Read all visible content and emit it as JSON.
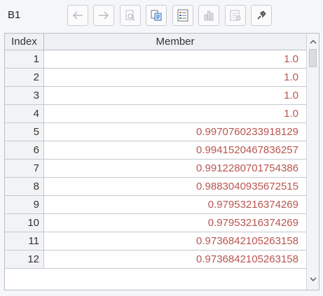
{
  "toolbar": {
    "cell_name": "B1",
    "buttons": [
      {
        "name": "back",
        "icon": "arrow-left-icon"
      },
      {
        "name": "forward",
        "icon": "arrow-right-icon"
      },
      {
        "name": "preview",
        "icon": "magnifier-page-icon"
      },
      {
        "name": "copy",
        "icon": "copy-icon"
      },
      {
        "name": "list",
        "icon": "list-form-icon"
      },
      {
        "name": "chart",
        "icon": "bar-chart-icon"
      },
      {
        "name": "settings",
        "icon": "table-settings-icon"
      },
      {
        "name": "pin",
        "icon": "pin-icon"
      }
    ]
  },
  "grid": {
    "headers": {
      "index": "Index",
      "member": "Member"
    },
    "rows": [
      {
        "index": "1",
        "member": "1.0"
      },
      {
        "index": "2",
        "member": "1.0"
      },
      {
        "index": "3",
        "member": "1.0"
      },
      {
        "index": "4",
        "member": "1.0"
      },
      {
        "index": "5",
        "member": "0.9970760233918129"
      },
      {
        "index": "6",
        "member": "0.9941520467836257"
      },
      {
        "index": "7",
        "member": "0.9912280701754386"
      },
      {
        "index": "8",
        "member": "0.9883040935672515"
      },
      {
        "index": "9",
        "member": "0.97953216374269"
      },
      {
        "index": "10",
        "member": "0.97953216374269"
      },
      {
        "index": "11",
        "member": "0.9736842105263158"
      },
      {
        "index": "12",
        "member": "0.9736842105263158"
      }
    ]
  },
  "colors": {
    "value_text": "#b9554f",
    "accent_blue": "#2f6fc4"
  }
}
